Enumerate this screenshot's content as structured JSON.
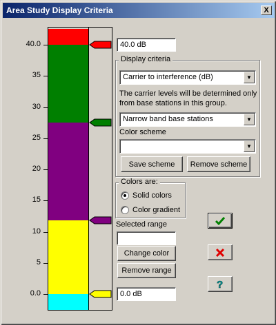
{
  "window": {
    "title": "Area Study Display Criteria",
    "close_label": "X"
  },
  "scale": {
    "ticks": [
      "40.0",
      "35",
      "30",
      "25",
      "20",
      "15",
      "10",
      "5",
      "0.0"
    ],
    "bands_db": [
      {
        "from": 40.0,
        "to": 42.5,
        "color": "#ff0000"
      },
      {
        "from": 27.5,
        "to": 40.0,
        "color": "#007f00"
      },
      {
        "from": 11.8,
        "to": 27.5,
        "color": "#800080"
      },
      {
        "from": 0.0,
        "to": 11.8,
        "color": "#ffff00"
      },
      {
        "from": -2.5,
        "to": 0.0,
        "color": "#00ffff"
      }
    ],
    "markers": [
      {
        "value_db": 40.0,
        "color": "#ff0000"
      },
      {
        "value_db": 27.5,
        "color": "#007f00"
      },
      {
        "value_db": 11.8,
        "color": "#800080"
      },
      {
        "value_db": 0.0,
        "color": "#ffff00"
      }
    ]
  },
  "upper_value": "40.0 dB",
  "lower_value": "0.0 dB",
  "display_criteria": {
    "group_label": "Display criteria",
    "mode_selected": "Carrier to interference (dB)",
    "note": "The carrier levels will be determined only from base stations in this group.",
    "stations_selected": "Narrow band base stations",
    "color_scheme_label": "Color scheme",
    "color_scheme_selected": "",
    "save_scheme_label": "Save scheme",
    "remove_scheme_label": "Remove scheme"
  },
  "colors_are": {
    "group_label": "Colors are:",
    "options": [
      {
        "label": "Solid colors",
        "selected": true
      },
      {
        "label": "Color gradient",
        "selected": false
      }
    ]
  },
  "selected_range": {
    "label": "Selected range",
    "value": "",
    "change_color_label": "Change color",
    "remove_range_label": "Remove range"
  },
  "actions": {
    "ok_icon": "check-icon",
    "cancel_icon": "x-icon",
    "help_icon": "question-icon"
  }
}
